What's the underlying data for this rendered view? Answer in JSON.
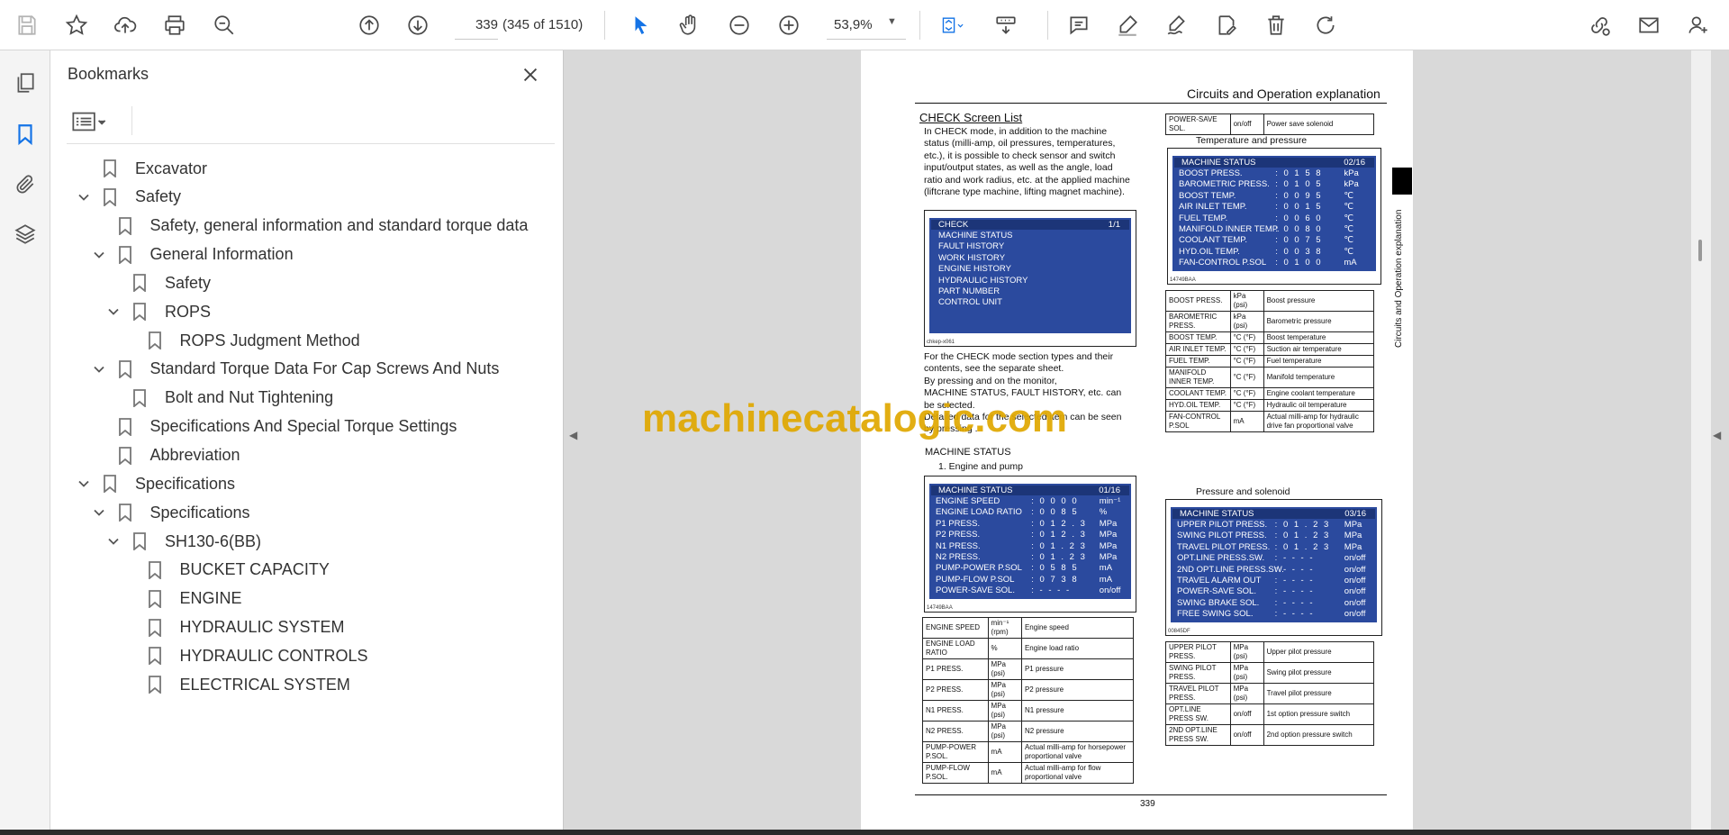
{
  "toolbar": {
    "page_value": "339",
    "page_count": "(345 of 1510)",
    "zoom_value": "53,9%"
  },
  "panel": {
    "title": "Bookmarks"
  },
  "bookmarks": [
    {
      "label": "Excavator",
      "level": 0,
      "expander": "none"
    },
    {
      "label": "Safety",
      "level": 0,
      "expander": "expanded"
    },
    {
      "label": "Safety, general information and standard torque data",
      "level": 1,
      "expander": "none"
    },
    {
      "label": "General Information",
      "level": 1,
      "expander": "expanded"
    },
    {
      "label": "Safety",
      "level": 2,
      "expander": "none"
    },
    {
      "label": "ROPS",
      "level": 2,
      "expander": "expanded"
    },
    {
      "label": "ROPS Judgment Method",
      "level": 3,
      "expander": "none"
    },
    {
      "label": "Standard Torque Data For Cap Screws And Nuts",
      "level": 1,
      "expander": "expanded"
    },
    {
      "label": "Bolt and Nut Tightening",
      "level": 2,
      "expander": "none"
    },
    {
      "label": "Specifications And Special Torque Settings",
      "level": 1,
      "expander": "none"
    },
    {
      "label": "Abbreviation",
      "level": 1,
      "expander": "none"
    },
    {
      "label": "Specifications",
      "level": 0,
      "expander": "expanded"
    },
    {
      "label": "Specifications",
      "level": 1,
      "expander": "expanded"
    },
    {
      "label": "SH130-6(BB)",
      "level": 2,
      "expander": "expanded"
    },
    {
      "label": "BUCKET CAPACITY",
      "level": 3,
      "expander": "none"
    },
    {
      "label": "ENGINE",
      "level": 3,
      "expander": "none"
    },
    {
      "label": "HYDRAULIC SYSTEM",
      "level": 3,
      "expander": "none"
    },
    {
      "label": "HYDRAULIC CONTROLS",
      "level": 3,
      "expander": "none"
    },
    {
      "label": "ELECTRICAL SYSTEM",
      "level": 3,
      "expander": "none"
    }
  ],
  "document": {
    "header": "Circuits and Operation explanation",
    "side_label": "Circuits and Operation explanation",
    "section_title": "CHECK Screen List",
    "intro": "In CHECK mode, in addition to the machine status (milli-amp, oil pressures, temperatures, etc.), it is possible to check sensor and switch input/output states, as well as the angle, load ratio and work radius, etc. at the applied machine (liftcrane type machine, lifting magnet machine).",
    "after_lines": [
      "For the CHECK mode section types and their",
      "contents, see the separate sheet.",
      "By pressing    and    on the monitor,",
      "MACHINE STATUS, FAULT HISTORY, etc. can",
      "be selected.",
      "Detailed data for the selected item can be seen",
      "by pressing   ."
    ],
    "machine_status_title": "MACHINE STATUS",
    "engine_pump_title": "1. Engine and pump",
    "temp_title": "Temperature and pressure",
    "press_title": "Pressure and solenoid",
    "page_number": "339",
    "check_screen": {
      "title": "CHECK",
      "page": "1/1",
      "items": [
        "MACHINE STATUS",
        "FAULT HISTORY",
        "WORK HISTORY",
        "ENGINE HISTORY",
        "HYDRAULIC HISTORY",
        "PART NUMBER",
        "CONTROL UNIT"
      ],
      "caption": "chkep-x061"
    },
    "engine_screen": {
      "title": "MACHINE STATUS",
      "page": "01/16",
      "rows": [
        {
          "label": "ENGINE SPEED",
          "value": ": 0 0 0 0",
          "unit": "min⁻¹"
        },
        {
          "label": "ENGINE LOAD RATIO",
          "value": ": 0 0 8 5",
          "unit": "%"
        },
        {
          "label": "P1 PRESS.",
          "value": ": 0 1 2 . 3",
          "unit": "MPa"
        },
        {
          "label": "P2 PRESS.",
          "value": ": 0 1 2 . 3",
          "unit": "MPa"
        },
        {
          "label": "N1 PRESS.",
          "value": ": 0 1 . 2 3",
          "unit": "MPa"
        },
        {
          "label": "N2 PRESS.",
          "value": ": 0 1 . 2 3",
          "unit": "MPa"
        },
        {
          "label": "PUMP-POWER P.SOL",
          "value": ": 0 5 8 5",
          "unit": "mA"
        },
        {
          "label": "PUMP-FLOW P.SOL",
          "value": ": 0 7 3 8",
          "unit": "mA"
        },
        {
          "label": "POWER-SAVE SOL.",
          "value": ": - - - -",
          "unit": "on/off"
        }
      ],
      "caption": "14749BAA"
    },
    "temp_screen": {
      "title": "MACHINE STATUS",
      "page": "02/16",
      "rows": [
        {
          "label": "BOOST PRESS.",
          "value": ": 0 1 5 8",
          "unit": "kPa"
        },
        {
          "label": "BAROMETRIC PRESS.",
          "value": ": 0 1 0 5",
          "unit": "kPa"
        },
        {
          "label": "BOOST TEMP.",
          "value": ": 0 0 9 5",
          "unit": "℃"
        },
        {
          "label": "AIR INLET TEMP.",
          "value": ": 0 0 1 5",
          "unit": "℃"
        },
        {
          "label": "FUEL TEMP.",
          "value": ": 0 0 6 0",
          "unit": "℃"
        },
        {
          "label": "MANIFOLD INNER TEMP.",
          "value": ": 0 0 8 0",
          "unit": "℃"
        },
        {
          "label": "COOLANT TEMP.",
          "value": ": 0 0 7 5",
          "unit": "℃"
        },
        {
          "label": "HYD.OIL TEMP.",
          "value": ": 0 0 3 8",
          "unit": "℃"
        },
        {
          "label": "FAN-CONTROL P.SOL",
          "value": ": 0 1 0 0",
          "unit": "mA"
        }
      ],
      "caption": "14749BAA"
    },
    "press_screen": {
      "title": "MACHINE STATUS",
      "page": "03/16",
      "rows": [
        {
          "label": "UPPER PILOT PRESS.",
          "value": ": 0 1 . 2 3",
          "unit": "MPa"
        },
        {
          "label": "SWING PILOT PRESS.",
          "value": ": 0 1 . 2 3",
          "unit": "MPa"
        },
        {
          "label": "TRAVEL PILOT PRESS.",
          "value": ": 0 1 . 2 3",
          "unit": "MPa"
        },
        {
          "label": "OPT.LINE PRESS.SW.",
          "value": ": - - - -",
          "unit": "on/off"
        },
        {
          "label": "2ND OPT.LINE PRESS.SW.",
          "value": ": - - - -",
          "unit": "on/off"
        },
        {
          "label": "TRAVEL ALARM OUT",
          "value": ": - - - -",
          "unit": "on/off"
        },
        {
          "label": "POWER-SAVE SOL.",
          "value": ": - - - -",
          "unit": "on/off"
        },
        {
          "label": "SWING BRAKE SOL.",
          "value": ": - - - -",
          "unit": "on/off"
        },
        {
          "label": "FREE SWING SOL.",
          "value": ": - - - -",
          "unit": "on/off"
        }
      ],
      "caption": "00845DF"
    },
    "power_save_table": [
      [
        "POWER-SAVE SOL.",
        "on/off",
        "Power save solenoid"
      ]
    ],
    "engine_table": [
      [
        "ENGINE SPEED",
        "min⁻¹ (rpm)",
        "Engine speed"
      ],
      [
        "ENGINE LOAD RATIO",
        "%",
        "Engine load ratio"
      ],
      [
        "P1 PRESS.",
        "MPa (psi)",
        "P1 pressure"
      ],
      [
        "P2 PRESS.",
        "MPa (psi)",
        "P2 pressure"
      ],
      [
        "N1 PRESS.",
        "MPa (psi)",
        "N1 pressure"
      ],
      [
        "N2 PRESS.",
        "MPa (psi)",
        "N2 pressure"
      ],
      [
        "PUMP-POWER P.SOL.",
        "mA",
        "Actual milli-amp for horsepower proportional valve"
      ],
      [
        "PUMP-FLOW P.SOL.",
        "mA",
        "Actual milli-amp for flow proportional valve"
      ]
    ],
    "temp_table": [
      [
        "BOOST PRESS.",
        "kPa (psi)",
        "Boost pressure"
      ],
      [
        "BAROMETRIC PRESS.",
        "kPa (psi)",
        "Barometric pressure"
      ],
      [
        "BOOST TEMP.",
        "°C (°F)",
        "Boost temperature"
      ],
      [
        "AIR INLET TEMP.",
        "°C (°F)",
        "Suction air temperature"
      ],
      [
        "FUEL TEMP.",
        "°C (°F)",
        "Fuel temperature"
      ],
      [
        "MANIFOLD INNER TEMP.",
        "°C (°F)",
        "Manifold temperature"
      ],
      [
        "COOLANT TEMP.",
        "°C (°F)",
        "Engine coolant temperature"
      ],
      [
        "HYD.OIL TEMP.",
        "°C (°F)",
        "Hydraulic oil temperature"
      ],
      [
        "FAN-CONTROL P.SOL",
        "mA",
        "Actual milli-amp for hydraulic drive fan proportional valve"
      ]
    ],
    "press_table": [
      [
        "UPPER PILOT PRESS.",
        "MPa (psi)",
        "Upper pilot pressure"
      ],
      [
        "SWING PILOT PRESS.",
        "MPa (psi)",
        "Swing pilot pressure"
      ],
      [
        "TRAVEL PILOT PRESS.",
        "MPa (psi)",
        "Travel pilot pressure"
      ],
      [
        "OPT.LINE PRESS SW.",
        "on/off",
        "1st option pressure switch"
      ],
      [
        "2ND OPT.LINE PRESS SW.",
        "on/off",
        "2nd option pressure switch"
      ]
    ]
  },
  "watermark": "machinecatalogic.com",
  "icons": {
    "save": "save-icon",
    "star": "star-icon",
    "upload": "upload-icon",
    "print": "print-icon",
    "zoom_search": "zoom-search-icon",
    "prev_page": "arrow-up-circle-icon",
    "next_page": "arrow-down-circle-icon",
    "select": "cursor-arrow-icon",
    "hand": "hand-icon",
    "zoom_out": "minus-circle-icon",
    "zoom_in": "plus-circle-icon",
    "fit": "fit-page-icon",
    "scroll_mode": "scroll-mode-icon",
    "comment": "comment-icon",
    "highlight": "highlighter-icon",
    "sign": "sign-pen-icon",
    "edit": "edit-document-icon",
    "delete": "trash-icon",
    "rotate": "rotate-icon",
    "share_link": "link-icon",
    "email": "envelope-icon",
    "account": "account-add-icon"
  },
  "colors": {
    "accent": "#1473e6",
    "screen_blue": "#2b4a9e",
    "watermark": "#e0a800"
  }
}
